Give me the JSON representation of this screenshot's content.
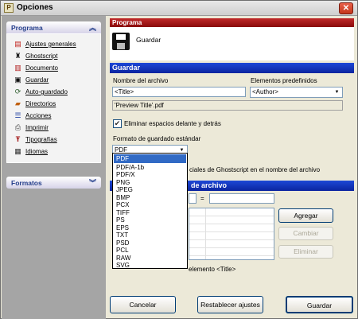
{
  "window": {
    "title": "Opciones",
    "close_glyph": "✕"
  },
  "sidebar": {
    "programa_group": {
      "title": "Programa",
      "items": [
        {
          "label": "Ajustes generales",
          "icon": "document-red-icon"
        },
        {
          "label": "Ghostscript",
          "icon": "ghostscript-icon"
        },
        {
          "label": "Documento",
          "icon": "document-icon"
        },
        {
          "label": "Guardar",
          "icon": "floppy-disk-icon"
        },
        {
          "label": "Auto-guardado",
          "icon": "auto-save-icon"
        },
        {
          "label": "Directorios",
          "icon": "folder-icon"
        },
        {
          "label": "Acciones",
          "icon": "actions-icon"
        },
        {
          "label": "Imprimir",
          "icon": "printer-icon"
        },
        {
          "label": "Tipografías",
          "icon": "fonts-icon"
        },
        {
          "label": "Idiomas",
          "icon": "languages-icon"
        }
      ]
    },
    "formatos_group": {
      "title": "Formatos"
    }
  },
  "header": {
    "section_label": "Programa",
    "page_title": "Guardar"
  },
  "guardar": {
    "section_title": "Guardar",
    "filename_label": "Nombre del archivo",
    "filename_value": "<Title>",
    "presets_label": "Elementos predefinidos",
    "presets_value": "<Author>",
    "preview_value": "'Preview Title'.pdf",
    "remove_spaces_label": "Eliminar espacios delante y detrás",
    "remove_spaces_checked": true,
    "default_format_label": "Formato de guardado estándar",
    "default_format_value": "PDF",
    "ghostscript_chars_label_visible": "ciales de Ghostscript en el nombre del archivo",
    "substitute_section_title_visible": "de archivo",
    "equals_sign": "=",
    "add_button": "Agregar",
    "change_button": "Cambiar",
    "remove_button": "Eliminar",
    "title_only_label_visible": "elemento <Title>"
  },
  "format_options": [
    "PDF",
    "PDF/A-1b",
    "PDF/X",
    "PNG",
    "JPEG",
    "BMP",
    "PCX",
    "TIFF",
    "PS",
    "EPS",
    "TXT",
    "PSD",
    "PCL",
    "RAW",
    "SVG"
  ],
  "selected_format": "PDF",
  "footer": {
    "cancel_button": "Cancelar",
    "reset_button": "Restablecer ajustes",
    "save_button": "Guardar"
  }
}
